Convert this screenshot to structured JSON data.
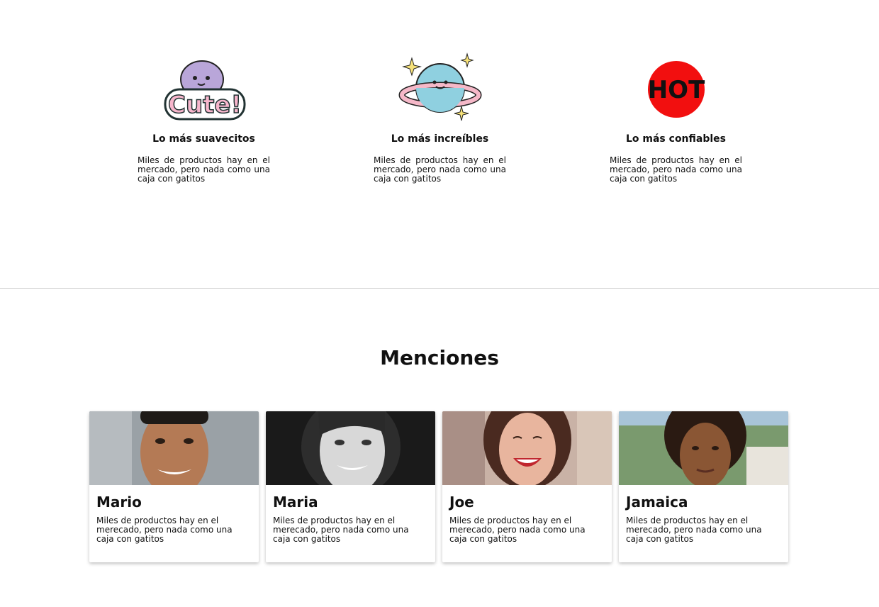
{
  "features": [
    {
      "icon": "cute-sticker-icon",
      "title": "Lo más suavecitos",
      "text": "Miles de productos hay en el mercado, pero nada como una caja con gatitos",
      "sticker_text": "Cute!"
    },
    {
      "icon": "planet-sticker-icon",
      "title": "Lo más increíbles",
      "text": "Miles de productos hay en el mercado, pero nada como una caja con gatitos"
    },
    {
      "icon": "hot-sticker-icon",
      "title": "Lo más confiables",
      "text": "Miles de productos hay en el mercado, pero nada como una caja con gatitos",
      "sticker_text": "HOT"
    }
  ],
  "mentions": {
    "title": "Menciones",
    "cards": [
      {
        "name": "Mario",
        "text": "Miles de productos hay en el merecado, pero nada como una caja con gatitos",
        "photo": "man-smiling-photo"
      },
      {
        "name": "Maria",
        "text": "Miles de productos hay en el merecado, pero nada como una caja con gatitos",
        "photo": "woman-bw-photo"
      },
      {
        "name": "Joe",
        "text": "Miles de productos hay en el merecado, pero nada como una caja con gatitos",
        "photo": "woman-laughing-photo"
      },
      {
        "name": "Jamaica",
        "text": "Miles de productos hay en el merecado, pero nada como una caja con gatitos",
        "photo": "woman-curly-hair-photo"
      }
    ]
  },
  "colors": {
    "hot_red": "#f20f0f",
    "planet_blue": "#8fd0e0",
    "ring_pink": "#f5b8c8",
    "cute_purple": "#b9a6d9"
  }
}
